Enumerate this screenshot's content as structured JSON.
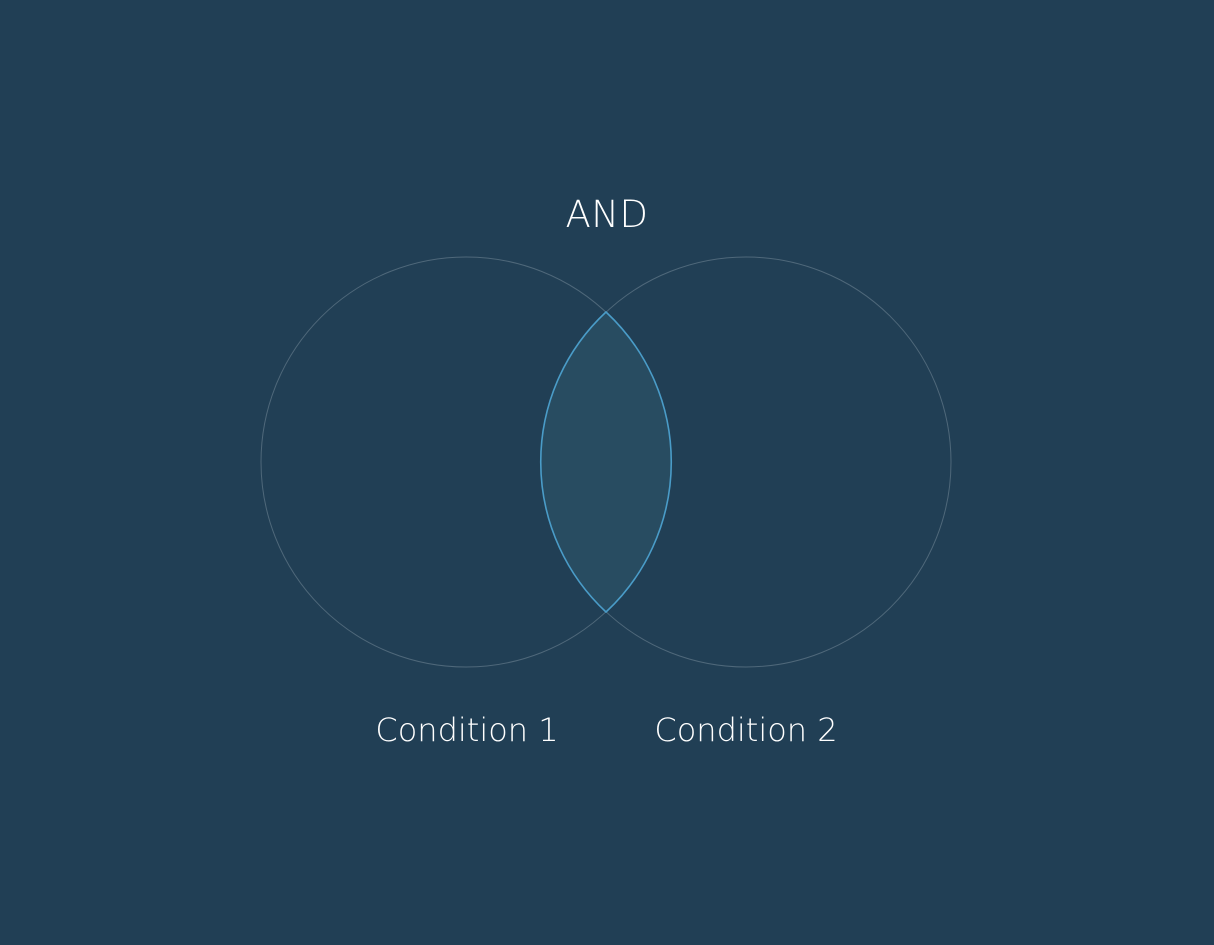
{
  "diagram": {
    "title": "AND",
    "sets": [
      {
        "label": "Condition 1"
      },
      {
        "label": "Condition 2"
      }
    ],
    "highlighted_region": "intersection"
  },
  "colors": {
    "background": "#213f55",
    "text": "#ffffff",
    "circle_outline": "#4f687a",
    "intersection_fill": "#284c61",
    "intersection_outline": "#4a9cc8"
  }
}
